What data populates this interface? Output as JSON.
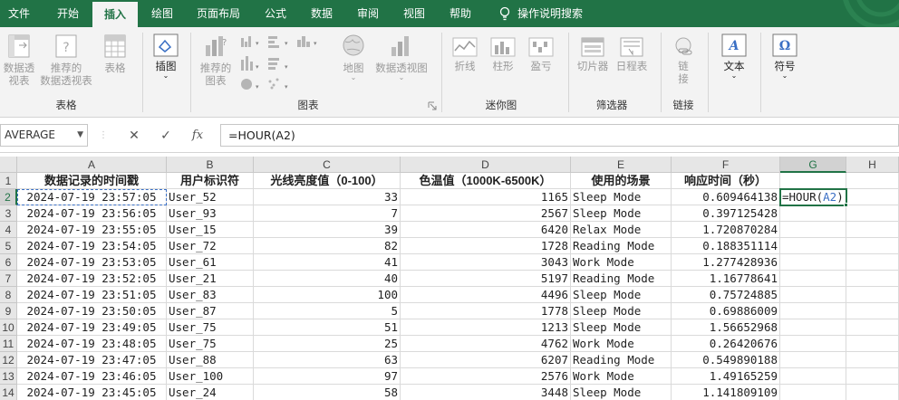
{
  "ribbon_tabs": [
    "文件",
    "开始",
    "插入",
    "绘图",
    "页面布局",
    "公式",
    "数据",
    "审阅",
    "视图",
    "帮助"
  ],
  "active_tab": "插入",
  "tell_me": "操作说明搜索",
  "ribbon": {
    "pivot": {
      "line1": "数据透",
      "line2": "视表"
    },
    "rec_pivot": {
      "line1": "推荐的",
      "line2": "数据透视表"
    },
    "table": "表格",
    "group_table": "表格",
    "illustrations": "插图",
    "rec_charts": {
      "line1": "推荐的",
      "line2": "图表"
    },
    "map": "地图",
    "pivot_chart": "数据透视图",
    "group_charts": "图表",
    "sparkline_line": "折线",
    "sparkline_column": "柱形",
    "sparkline_winloss": "盈亏",
    "group_sparklines": "迷你图",
    "slicer": "切片器",
    "timeline": "日程表",
    "group_filters": "筛选器",
    "link": {
      "line1": "链",
      "line2": "接"
    },
    "group_links": "链接",
    "text": "文本",
    "symbol": "符号"
  },
  "name_box": "AVERAGE",
  "formula": "=HOUR(A2)",
  "columns": [
    "A",
    "B",
    "C",
    "D",
    "E",
    "F",
    "G",
    "H"
  ],
  "header_row": [
    "数据记录的时间戳",
    "用户标识符",
    "光线亮度值（0-100）",
    "色温值（1000K-6500K）",
    "使用的场景",
    "响应时间（秒）"
  ],
  "rows": [
    [
      "2024-07-19 23:57:05",
      "User_52",
      "33",
      "1165",
      "Sleep Mode",
      "0.609464138"
    ],
    [
      "2024-07-19 23:56:05",
      "User_93",
      "7",
      "2567",
      "Sleep Mode",
      "0.397125428"
    ],
    [
      "2024-07-19 23:55:05",
      "User_15",
      "39",
      "6420",
      "Relax Mode",
      "1.720870284"
    ],
    [
      "2024-07-19 23:54:05",
      "User_72",
      "82",
      "1728",
      "Reading Mode",
      "0.188351114"
    ],
    [
      "2024-07-19 23:53:05",
      "User_61",
      "41",
      "3043",
      "Work Mode",
      "1.277428936"
    ],
    [
      "2024-07-19 23:52:05",
      "User_21",
      "40",
      "5197",
      "Reading Mode",
      "1.16778641"
    ],
    [
      "2024-07-19 23:51:05",
      "User_83",
      "100",
      "4496",
      "Sleep Mode",
      "0.75724885"
    ],
    [
      "2024-07-19 23:50:05",
      "User_87",
      "5",
      "1778",
      "Sleep Mode",
      "0.69886009"
    ],
    [
      "2024-07-19 23:49:05",
      "User_75",
      "51",
      "1213",
      "Sleep Mode",
      "1.56652968"
    ],
    [
      "2024-07-19 23:48:05",
      "User_75",
      "25",
      "4762",
      "Work Mode",
      "0.26420676"
    ],
    [
      "2024-07-19 23:47:05",
      "User_88",
      "63",
      "6207",
      "Reading Mode",
      "0.549890188"
    ],
    [
      "2024-07-19 23:46:05",
      "User_100",
      "97",
      "2576",
      "Work Mode",
      "1.49165259"
    ],
    [
      "2024-07-19 23:45:05",
      "User_24",
      "58",
      "3448",
      "Sleep Mode",
      "1.141809109"
    ]
  ],
  "editing_cell": {
    "prefix": "=HOUR(",
    "ref": "A2",
    "suffix": ")"
  }
}
